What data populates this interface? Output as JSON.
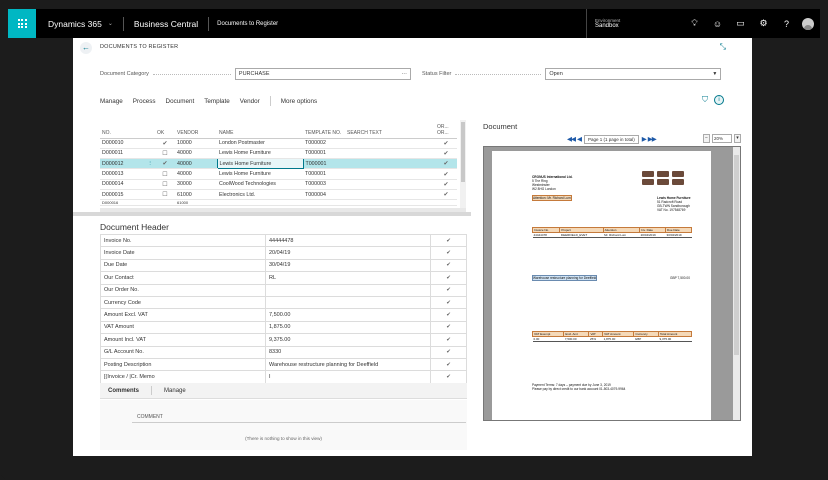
{
  "topbar": {
    "product": "Dynamics 365",
    "app": "Business Central",
    "breadcrumb": "Documents to Register",
    "env_label": "Environment",
    "env_value": "Sandbox"
  },
  "page": {
    "title": "DOCUMENTS TO REGISTER",
    "category_label": "Document Category",
    "category_value": "PURCHASE",
    "category_ellipsis": "···",
    "status_label": "Status Filter",
    "status_value": "Open"
  },
  "actions": [
    "Manage",
    "Process",
    "Document",
    "Template",
    "Vendor",
    "More options"
  ],
  "list": {
    "headers": {
      "no": "NO.",
      "ok": "OK",
      "vendor": "VENDOR",
      "name": "NAME",
      "template": "TEMPLATE NO.",
      "search": "SEARCH TEXT",
      "or": "OR... OR..."
    },
    "rows": [
      {
        "no": "D000010",
        "ok": "✔",
        "vendor": "10000",
        "name": "London Postmaster",
        "template": "T000002",
        "or": "✔"
      },
      {
        "no": "D000011",
        "ok": "☐",
        "vendor": "40000",
        "name": "Lewis Home Furniture",
        "template": "T000001",
        "or": "✔"
      },
      {
        "no": "D000012",
        "ok": "✔",
        "vendor": "40000",
        "name": "Lewis Home Furniture",
        "template": "T000001",
        "or": "✔"
      },
      {
        "no": "D000013",
        "ok": "☐",
        "vendor": "40000",
        "name": "Lewis Home Furniture",
        "template": "T000001",
        "or": "✔"
      },
      {
        "no": "D000014",
        "ok": "☐",
        "vendor": "30000",
        "name": "CoolWood Technologies",
        "template": "T000003",
        "or": "✔"
      },
      {
        "no": "D000015",
        "ok": "☐",
        "vendor": "61000",
        "name": "Electronics Ltd.",
        "template": "T000004",
        "or": "✔"
      },
      {
        "no": "D000016",
        "ok": "",
        "vendor": "61000",
        "name": "",
        "template": "",
        "or": ""
      }
    ]
  },
  "header_section": {
    "title": "Document Header",
    "rows": [
      {
        "label": "Invoice No.",
        "value": "44444478",
        "check": "✔"
      },
      {
        "label": "Invoice Date",
        "value": "20/04/19",
        "check": "✔"
      },
      {
        "label": "Due Date",
        "value": "30/04/19",
        "check": "✔"
      },
      {
        "label": "Our Contact",
        "value": "RL",
        "check": "✔"
      },
      {
        "label": "Our Order No.",
        "value": "",
        "check": "✔"
      },
      {
        "label": "Currency Code",
        "value": "",
        "check": "✔"
      },
      {
        "label": "Amount Excl. VAT",
        "value": "7,500.00",
        "check": "✔"
      },
      {
        "label": "VAT Amount",
        "value": "1,875.00",
        "check": "✔"
      },
      {
        "label": "Amount Incl. VAT",
        "value": "9,375.00",
        "check": "✔"
      },
      {
        "label": "G/L Account No.",
        "value": "8330",
        "check": "✔"
      },
      {
        "label": "Posting Description",
        "value": "Warehouse restructure planning for Deeffield",
        "check": "✔"
      },
      {
        "label": "[(Invoice / |Cr. Memo",
        "value": "I",
        "check": "✔"
      }
    ]
  },
  "comments": {
    "tab1": "Comments",
    "tab2": "Manage",
    "column": "COMMENT",
    "empty": "(There is nothing to show in this view)"
  },
  "document": {
    "title": "Document",
    "page_text": "Page 1 (1 page in total)",
    "zoom": "20%",
    "sender": [
      "CRONUS International Ltd.",
      "5 The Ring",
      "Westminster",
      "W2 8HG London"
    ],
    "attention": "Attention: Mr. Richard Lum",
    "recipient": [
      "Lewis Home Furniture",
      "51 Radcroft Road",
      "GB-TWN Sandborough",
      "VAT No. 197548769"
    ],
    "info_headers": [
      "Invoice No.",
      "Project",
      "Attention",
      "Inv. Date",
      "Due Date"
    ],
    "info_values": [
      "44444478",
      "DEERFIELD_EVET",
      "Mr. Richard Lum",
      "20/04/2019",
      "30/04/2019"
    ],
    "line_text": "Warehouse restructure planning for Deeffield",
    "line_amount": "GBP 7,500.00",
    "vat_headers": [
      "VAT Exempt",
      "Excl. Amt",
      "VAT",
      "VAT Amount",
      "Currency",
      "Total Amount"
    ],
    "vat_values": [
      "0.00",
      "7,500.00",
      "25%",
      "1,875.00",
      "GBP",
      "9,375.00"
    ],
    "footer": [
      "Payment Terms: 7 days – payment due by June 3, 2019",
      "Please pay by direct credit to our bank account 01-503-4079-9964"
    ]
  }
}
